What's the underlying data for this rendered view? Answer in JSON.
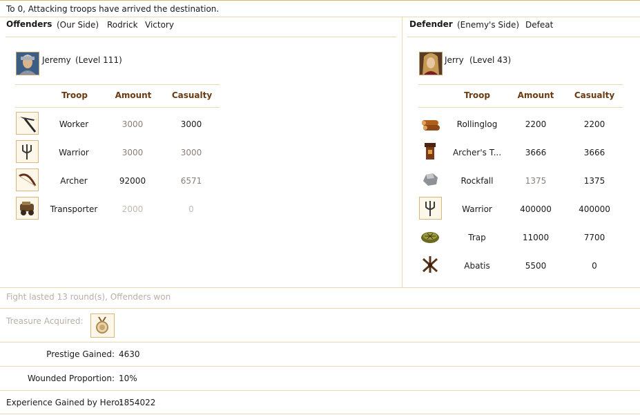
{
  "header": {
    "message": "To 0, Attacking troops have arrived the destination."
  },
  "offenders": {
    "title": "Offenders",
    "side": "(Our Side)",
    "name": "Rodrick",
    "result": "Victory",
    "hero": {
      "name": "Jeremy",
      "level": "(Level 111)"
    },
    "columns": {
      "troop": "Troop",
      "amount": "Amount",
      "casualty": "Casualty"
    },
    "troops": [
      {
        "icon": "pickaxe-icon",
        "name": "Worker",
        "amount": "3000",
        "casualty": "3000"
      },
      {
        "icon": "trident-icon",
        "name": "Warrior",
        "amount": "3000",
        "casualty": "3000"
      },
      {
        "icon": "bow-icon",
        "name": "Archer",
        "amount": "92000",
        "casualty": "6571"
      },
      {
        "icon": "cart-icon",
        "name": "Transporter",
        "amount": "2000",
        "casualty": "0"
      }
    ]
  },
  "defender": {
    "title": "Defender",
    "side": "(Enemy's Side)",
    "result": "Defeat",
    "hero": {
      "name": "Jerry",
      "level": "(Level 43)"
    },
    "columns": {
      "troop": "Troop",
      "amount": "Amount",
      "casualty": "Casualty"
    },
    "troops": [
      {
        "icon": "logs-icon",
        "name": "Rollinglog",
        "amount": "2200",
        "casualty": "2200"
      },
      {
        "icon": "tower-icon",
        "name": "Archer's T...",
        "amount": "3666",
        "casualty": "3666"
      },
      {
        "icon": "rock-icon",
        "name": "Rockfall",
        "amount": "1375",
        "casualty": "1375"
      },
      {
        "icon": "trident-icon",
        "name": "Warrior",
        "amount": "400000",
        "casualty": "400000"
      },
      {
        "icon": "trap-icon",
        "name": "Trap",
        "amount": "11000",
        "casualty": "7700"
      },
      {
        "icon": "abatis-icon",
        "name": "Abatis",
        "amount": "5500",
        "casualty": "0"
      }
    ]
  },
  "summary": {
    "fight": "Fight lasted 13 round(s), Offenders won",
    "treasure_label": "Treasure Acquired:",
    "prestige_label": "Prestige Gained:",
    "prestige_value": "4630",
    "wounded_label": "Wounded Proportion:",
    "wounded_value": "10%",
    "experience_label": "Experience Gained by Hero:",
    "experience_value": "1854022"
  }
}
